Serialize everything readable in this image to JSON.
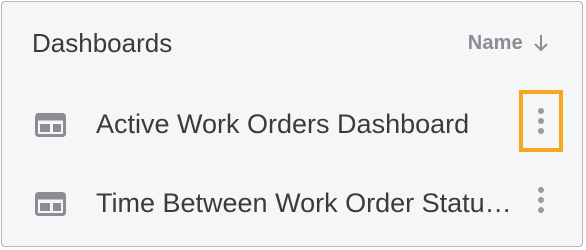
{
  "panel": {
    "title": "Dashboards",
    "sort": {
      "label": "Name",
      "direction_icon": "arrow-down-icon"
    }
  },
  "items": [
    {
      "label": "Active Work Orders Dashboard",
      "icon": "dashboard-icon",
      "menu_icon": "kebab-menu-icon",
      "menu_highlighted": true
    },
    {
      "label": "Time Between Work Order Status Changes",
      "icon": "dashboard-icon",
      "menu_icon": "kebab-menu-icon",
      "menu_highlighted": false
    }
  ],
  "colors": {
    "highlight": "#f5a623",
    "text": "#3a3b3d",
    "muted": "#8b8d91",
    "panel_bg": "#f5f6f7"
  }
}
